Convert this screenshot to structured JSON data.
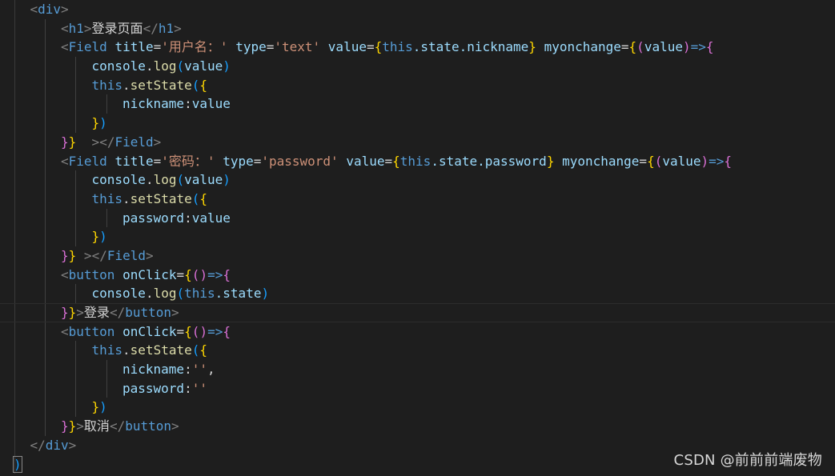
{
  "editor": {
    "theme_colors": {
      "background": "#1e1e1e",
      "tag": "#569cd6",
      "attribute": "#9cdcfe",
      "string": "#ce9178",
      "brace_level1": "#ffd700",
      "brace_level2": "#da70d6",
      "brace_level3": "#179fff",
      "text": "#d4d4d4"
    },
    "lines": [
      {
        "indent": 1,
        "tokens": [
          {
            "t": "<",
            "c": "bracket"
          },
          {
            "t": "div",
            "c": "tag"
          },
          {
            "t": ">",
            "c": "bracket"
          }
        ]
      },
      {
        "indent": 2,
        "tokens": [
          {
            "t": "<",
            "c": "bracket"
          },
          {
            "t": "h1",
            "c": "tag"
          },
          {
            "t": ">",
            "c": "bracket"
          },
          {
            "t": "登录页面",
            "c": "text"
          },
          {
            "t": "</",
            "c": "bracket"
          },
          {
            "t": "h1",
            "c": "tag"
          },
          {
            "t": ">",
            "c": "bracket"
          }
        ]
      },
      {
        "indent": 2,
        "tokens": [
          {
            "t": "<",
            "c": "bracket"
          },
          {
            "t": "Field",
            "c": "tag"
          },
          {
            "t": " ",
            "c": "plain"
          },
          {
            "t": "title",
            "c": "attr"
          },
          {
            "t": "=",
            "c": "op"
          },
          {
            "t": "'用户名：'",
            "c": "str"
          },
          {
            "t": " ",
            "c": "plain"
          },
          {
            "t": "type",
            "c": "attr"
          },
          {
            "t": "=",
            "c": "op"
          },
          {
            "t": "'text'",
            "c": "str"
          },
          {
            "t": " ",
            "c": "plain"
          },
          {
            "t": "value",
            "c": "attr"
          },
          {
            "t": "=",
            "c": "op"
          },
          {
            "t": "{",
            "c": "brace1"
          },
          {
            "t": "this",
            "c": "kw"
          },
          {
            "t": ".state.nickname",
            "c": "var"
          },
          {
            "t": "}",
            "c": "brace1"
          },
          {
            "t": " ",
            "c": "plain"
          },
          {
            "t": "myonchange",
            "c": "attr"
          },
          {
            "t": "=",
            "c": "op"
          },
          {
            "t": "{",
            "c": "brace1"
          },
          {
            "t": "(",
            "c": "brace2"
          },
          {
            "t": "value",
            "c": "var"
          },
          {
            "t": ")",
            "c": "brace2"
          },
          {
            "t": "=>",
            "c": "kw"
          },
          {
            "t": "{",
            "c": "brace2"
          }
        ]
      },
      {
        "indent": 3,
        "tokens": [
          {
            "t": "console",
            "c": "var"
          },
          {
            "t": ".",
            "c": "op"
          },
          {
            "t": "log",
            "c": "fn"
          },
          {
            "t": "(",
            "c": "brace3"
          },
          {
            "t": "value",
            "c": "var"
          },
          {
            "t": ")",
            "c": "brace3"
          }
        ]
      },
      {
        "indent": 3,
        "tokens": [
          {
            "t": "this",
            "c": "kw"
          },
          {
            "t": ".",
            "c": "op"
          },
          {
            "t": "setState",
            "c": "fn"
          },
          {
            "t": "(",
            "c": "brace3"
          },
          {
            "t": "{",
            "c": "brace1"
          }
        ]
      },
      {
        "indent": 4,
        "tokens": [
          {
            "t": "nickname",
            "c": "var"
          },
          {
            "t": ":",
            "c": "op"
          },
          {
            "t": "value",
            "c": "var"
          }
        ]
      },
      {
        "indent": 3,
        "tokens": [
          {
            "t": "}",
            "c": "brace1"
          },
          {
            "t": ")",
            "c": "brace3"
          }
        ]
      },
      {
        "indent": 2,
        "tokens": [
          {
            "t": "}",
            "c": "brace2"
          },
          {
            "t": "}",
            "c": "brace1"
          },
          {
            "t": "  ",
            "c": "plain"
          },
          {
            "t": ">",
            "c": "bracket"
          },
          {
            "t": "</",
            "c": "bracket"
          },
          {
            "t": "Field",
            "c": "tag"
          },
          {
            "t": ">",
            "c": "bracket"
          }
        ]
      },
      {
        "indent": 2,
        "tokens": [
          {
            "t": "<",
            "c": "bracket"
          },
          {
            "t": "Field",
            "c": "tag"
          },
          {
            "t": " ",
            "c": "plain"
          },
          {
            "t": "title",
            "c": "attr"
          },
          {
            "t": "=",
            "c": "op"
          },
          {
            "t": "'密码：'",
            "c": "str"
          },
          {
            "t": " ",
            "c": "plain"
          },
          {
            "t": "type",
            "c": "attr"
          },
          {
            "t": "=",
            "c": "op"
          },
          {
            "t": "'password'",
            "c": "str"
          },
          {
            "t": " ",
            "c": "plain"
          },
          {
            "t": "value",
            "c": "attr"
          },
          {
            "t": "=",
            "c": "op"
          },
          {
            "t": "{",
            "c": "brace1"
          },
          {
            "t": "this",
            "c": "kw"
          },
          {
            "t": ".state.password",
            "c": "var"
          },
          {
            "t": "}",
            "c": "brace1"
          },
          {
            "t": " ",
            "c": "plain"
          },
          {
            "t": "myonchange",
            "c": "attr"
          },
          {
            "t": "=",
            "c": "op"
          },
          {
            "t": "{",
            "c": "brace1"
          },
          {
            "t": "(",
            "c": "brace2"
          },
          {
            "t": "value",
            "c": "var"
          },
          {
            "t": ")",
            "c": "brace2"
          },
          {
            "t": "=>",
            "c": "kw"
          },
          {
            "t": "{",
            "c": "brace2"
          }
        ]
      },
      {
        "indent": 3,
        "tokens": [
          {
            "t": "console",
            "c": "var"
          },
          {
            "t": ".",
            "c": "op"
          },
          {
            "t": "log",
            "c": "fn"
          },
          {
            "t": "(",
            "c": "brace3"
          },
          {
            "t": "value",
            "c": "var"
          },
          {
            "t": ")",
            "c": "brace3"
          }
        ]
      },
      {
        "indent": 3,
        "tokens": [
          {
            "t": "this",
            "c": "kw"
          },
          {
            "t": ".",
            "c": "op"
          },
          {
            "t": "setState",
            "c": "fn"
          },
          {
            "t": "(",
            "c": "brace3"
          },
          {
            "t": "{",
            "c": "brace1"
          }
        ]
      },
      {
        "indent": 4,
        "tokens": [
          {
            "t": "password",
            "c": "var"
          },
          {
            "t": ":",
            "c": "op"
          },
          {
            "t": "value",
            "c": "var"
          }
        ]
      },
      {
        "indent": 3,
        "tokens": [
          {
            "t": "}",
            "c": "brace1"
          },
          {
            "t": ")",
            "c": "brace3"
          }
        ]
      },
      {
        "indent": 2,
        "tokens": [
          {
            "t": "}",
            "c": "brace2"
          },
          {
            "t": "}",
            "c": "brace1"
          },
          {
            "t": " ",
            "c": "plain"
          },
          {
            "t": ">",
            "c": "bracket"
          },
          {
            "t": "</",
            "c": "bracket"
          },
          {
            "t": "Field",
            "c": "tag"
          },
          {
            "t": ">",
            "c": "bracket"
          }
        ]
      },
      {
        "indent": 2,
        "tokens": [
          {
            "t": "<",
            "c": "bracket"
          },
          {
            "t": "button",
            "c": "tag"
          },
          {
            "t": " ",
            "c": "plain"
          },
          {
            "t": "onClick",
            "c": "attr"
          },
          {
            "t": "=",
            "c": "op"
          },
          {
            "t": "{",
            "c": "brace1"
          },
          {
            "t": "(",
            "c": "brace2"
          },
          {
            "t": ")",
            "c": "brace2"
          },
          {
            "t": "=>",
            "c": "kw"
          },
          {
            "t": "{",
            "c": "brace2"
          }
        ]
      },
      {
        "indent": 3,
        "tokens": [
          {
            "t": "console",
            "c": "var"
          },
          {
            "t": ".",
            "c": "op"
          },
          {
            "t": "log",
            "c": "fn"
          },
          {
            "t": "(",
            "c": "brace3"
          },
          {
            "t": "this",
            "c": "kw"
          },
          {
            "t": ".state",
            "c": "var"
          },
          {
            "t": ")",
            "c": "brace3"
          }
        ]
      },
      {
        "indent": 2,
        "current": true,
        "tokens": [
          {
            "t": "}",
            "c": "brace2"
          },
          {
            "t": "}",
            "c": "brace1"
          },
          {
            "t": ">",
            "c": "bracket"
          },
          {
            "t": "登录",
            "c": "text"
          },
          {
            "t": "</",
            "c": "bracket"
          },
          {
            "t": "button",
            "c": "tag"
          },
          {
            "t": ">",
            "c": "bracket"
          }
        ]
      },
      {
        "indent": 2,
        "tokens": [
          {
            "t": "<",
            "c": "bracket"
          },
          {
            "t": "button",
            "c": "tag"
          },
          {
            "t": " ",
            "c": "plain"
          },
          {
            "t": "onClick",
            "c": "attr"
          },
          {
            "t": "=",
            "c": "op"
          },
          {
            "t": "{",
            "c": "brace1"
          },
          {
            "t": "(",
            "c": "brace2"
          },
          {
            "t": ")",
            "c": "brace2"
          },
          {
            "t": "=>",
            "c": "kw"
          },
          {
            "t": "{",
            "c": "brace2"
          }
        ]
      },
      {
        "indent": 3,
        "tokens": [
          {
            "t": "this",
            "c": "kw"
          },
          {
            "t": ".",
            "c": "op"
          },
          {
            "t": "setState",
            "c": "fn"
          },
          {
            "t": "(",
            "c": "brace3"
          },
          {
            "t": "{",
            "c": "brace1"
          }
        ]
      },
      {
        "indent": 4,
        "tokens": [
          {
            "t": "nickname",
            "c": "var"
          },
          {
            "t": ":",
            "c": "op"
          },
          {
            "t": "''",
            "c": "str"
          },
          {
            "t": ",",
            "c": "op"
          }
        ]
      },
      {
        "indent": 4,
        "tokens": [
          {
            "t": "password",
            "c": "var"
          },
          {
            "t": ":",
            "c": "op"
          },
          {
            "t": "''",
            "c": "str"
          }
        ]
      },
      {
        "indent": 3,
        "tokens": [
          {
            "t": "}",
            "c": "brace1"
          },
          {
            "t": ")",
            "c": "brace3"
          }
        ]
      },
      {
        "indent": 2,
        "tokens": [
          {
            "t": "}",
            "c": "brace2"
          },
          {
            "t": "}",
            "c": "brace1"
          },
          {
            "t": ">",
            "c": "bracket"
          },
          {
            "t": "取消",
            "c": "text"
          },
          {
            "t": "</",
            "c": "bracket"
          },
          {
            "t": "button",
            "c": "tag"
          },
          {
            "t": ">",
            "c": "bracket"
          }
        ]
      },
      {
        "indent": 1,
        "tokens": [
          {
            "t": "</",
            "c": "bracket"
          },
          {
            "t": "div",
            "c": "tag"
          },
          {
            "t": ">",
            "c": "bracket"
          }
        ]
      },
      {
        "indent": 0,
        "tokens": [
          {
            "t": ")",
            "c": "brace3",
            "cursor": true
          }
        ]
      }
    ]
  },
  "watermark": {
    "text": "CSDN @前前前端废物"
  }
}
